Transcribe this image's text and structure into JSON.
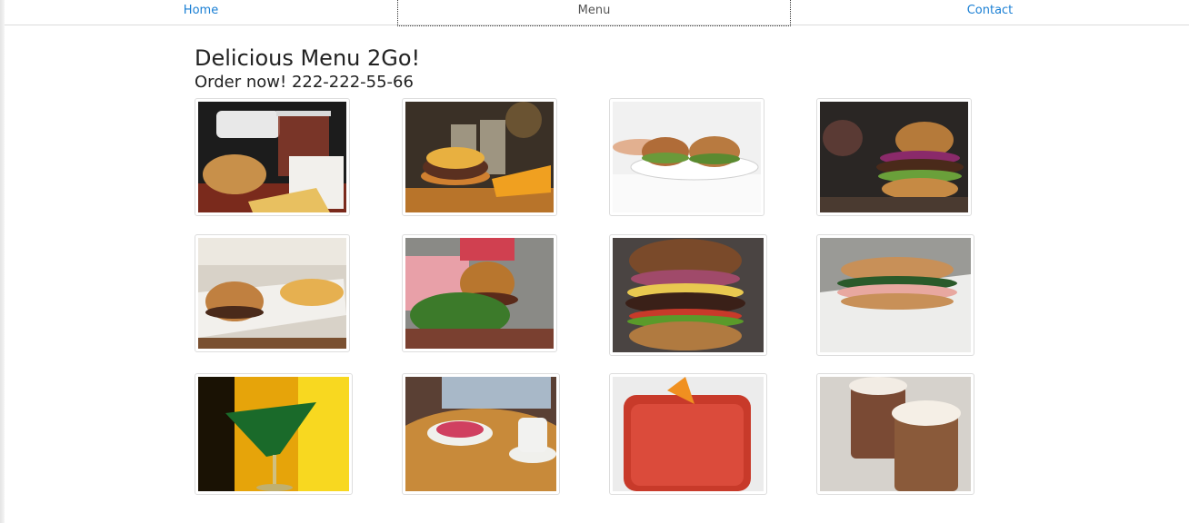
{
  "nav": {
    "home": "Home",
    "menu": "Menu",
    "contact": "Contact"
  },
  "header": {
    "title": "Delicious Menu 2Go!",
    "subtitle": "Order now! 222-222-55-66"
  },
  "gallery": {
    "items": [
      {
        "name": "burger-fries-drink-photo"
      },
      {
        "name": "burger-fries-beer-photo"
      },
      {
        "name": "burgers-on-plate-photo"
      },
      {
        "name": "burger-dark-background-photo"
      },
      {
        "name": "burger-tray-fries-photo"
      },
      {
        "name": "burger-salad-checkered-photo"
      },
      {
        "name": "burger-closeup-photo"
      },
      {
        "name": "sandwich-photo"
      },
      {
        "name": "green-martini-photo"
      },
      {
        "name": "dessert-coffee-photo"
      },
      {
        "name": "red-cocktail-photo"
      },
      {
        "name": "hot-chocolate-photo"
      }
    ]
  },
  "colors": {
    "link": "#1a7fd4",
    "text": "#222222",
    "thumb_border": "#dddddd"
  }
}
